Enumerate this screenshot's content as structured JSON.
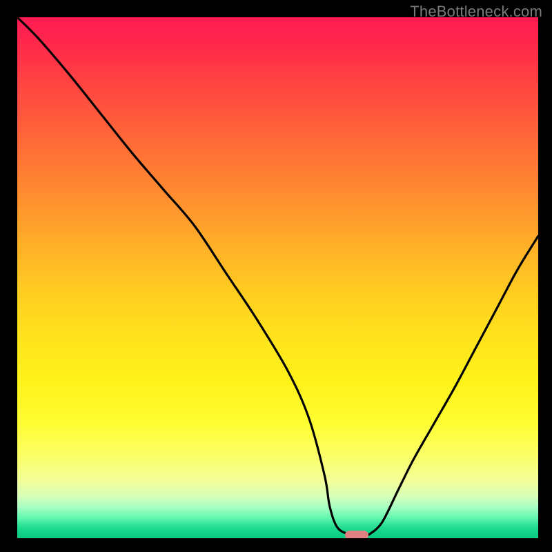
{
  "watermark": "TheBottleneck.com",
  "chart_data": {
    "type": "line",
    "title": "",
    "xlabel": "",
    "ylabel": "",
    "xlim": [
      0,
      100
    ],
    "ylim": [
      0,
      100
    ],
    "grid": false,
    "legend": false,
    "series": [
      {
        "name": "bottleneck-curve",
        "x": [
          0.0,
          4.0,
          10.0,
          16.0,
          22.0,
          28.0,
          34.0,
          40.0,
          46.0,
          52.0,
          56.0,
          59.0,
          60.0,
          61.5,
          64.0,
          66.5,
          67.5,
          70.0,
          73.0,
          76.0,
          80.0,
          84.0,
          88.0,
          92.0,
          96.0,
          100.0
        ],
        "values": [
          100,
          96.0,
          89.0,
          81.5,
          74.0,
          67.0,
          60.0,
          51.0,
          42.0,
          32.0,
          23.0,
          12.0,
          6.0,
          2.0,
          0.7,
          0.6,
          0.7,
          3.0,
          9.0,
          15.0,
          22.0,
          29.0,
          36.5,
          44.0,
          51.5,
          58.0
        ]
      }
    ],
    "annotations": [
      {
        "name": "optimal-marker",
        "x": 65.2,
        "y": 0.6,
        "color": "#e08080"
      }
    ],
    "background_gradient": {
      "top_color": "#ff1a52",
      "mid_color": "#ffe41c",
      "bottom_color": "#0acb82"
    }
  }
}
